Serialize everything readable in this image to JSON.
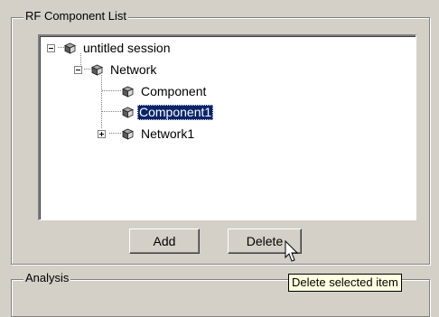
{
  "rf_group": {
    "title": "RF Component List"
  },
  "tree": {
    "nodes": [
      {
        "label": "untitled session",
        "expanded": true,
        "icon": "cube-icon"
      },
      {
        "label": "Network",
        "expanded": true,
        "icon": "cube-icon"
      },
      {
        "label": "Component",
        "icon": "cube-icon"
      },
      {
        "label": "Component1",
        "icon": "cube-icon",
        "selected": true
      },
      {
        "label": "Network1",
        "expanded": false,
        "icon": "cube-icon"
      }
    ]
  },
  "buttons": {
    "add": "Add",
    "delete": "Delete"
  },
  "analysis_group": {
    "title": "Analysis"
  },
  "tooltip": {
    "text": "Delete selected item"
  },
  "colors": {
    "selection": "#0a246a",
    "tooltip_bg": "#ffffe1",
    "face": "#d4d0c8"
  }
}
